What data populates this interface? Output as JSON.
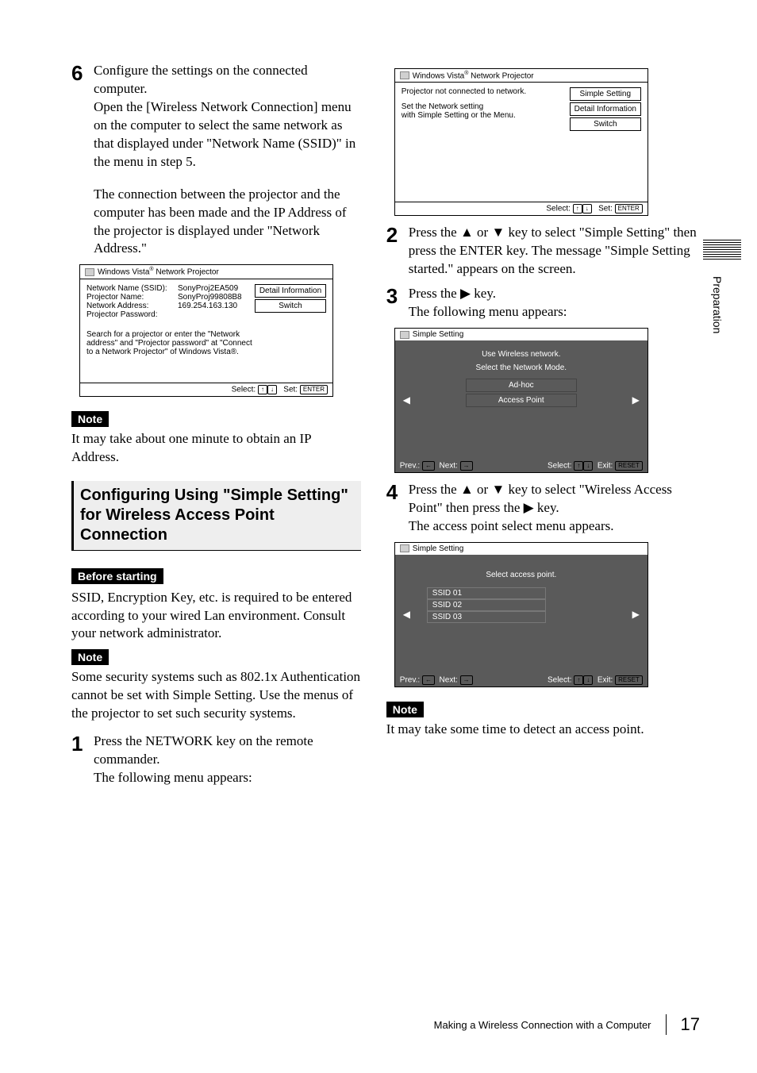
{
  "side_label": "Preparation",
  "left": {
    "step6_num": "6",
    "step6_a": "Configure the settings on the connected computer.",
    "step6_b": "Open the [Wireless Network Connection] menu on the computer to select the same network as that displayed under \"Network Name (SSID)\" in the menu in step 5.",
    "step6_c": "The connection between the projector and the computer has been made and the IP Address of the projector is displayed under \"Network Address.\"",
    "note1_label": "Note",
    "note1_text": "It may take about one minute to obtain an IP Address.",
    "section": "Configuring Using \"Simple Setting\" for Wireless Access Point Connection",
    "before_label": "Before starting",
    "before_text": "SSID, Encryption Key, etc. is required to be entered according to your wired Lan environment. Consult your network administrator.",
    "note2_label": "Note",
    "note2_text": "Some security systems such as 802.1x Authentication cannot be set with Simple Setting. Use the menus of the projector to set such security systems.",
    "step1_num": "1",
    "step1_a": "Press the NETWORK key on the remote commander.",
    "step1_b": "The following menu appears:"
  },
  "right": {
    "step2_num": "2",
    "step2_a": "Press the ▲ or ▼ key to select \"Simple Setting\" then press the ENTER key. The message \"Simple Setting started.\" appears on the screen.",
    "step3_num": "3",
    "step3_a": "Press the ▶ key.",
    "step3_b": "The following menu appears:",
    "step4_num": "4",
    "step4_a": "Press the ▲ or ▼ key to select \"Wireless Access Point\" then press the ▶ key.",
    "step4_b": "The access point select menu appears.",
    "note3_label": "Note",
    "note3_text": "It may take some time to detect an access point."
  },
  "panelA": {
    "title_pre": "Windows Vista",
    "title_post": " Network Projector",
    "rows": [
      {
        "label": "Network Name (SSID):",
        "val": "SonyProj2EA509"
      },
      {
        "label": "Projector Name:",
        "val": "SonyProj99808B8"
      },
      {
        "label": "Network Address:",
        "val": "169.254.163.130"
      },
      {
        "label": "Projector Password:",
        "val": ""
      }
    ],
    "btn1": "Detail Information",
    "btn2": "Switch",
    "msg": "Search for a projector or enter the \"Network address\" and \"Projector password\" at \"Connect to a Network Projector\" of Windows Vista®.",
    "foot_select": "Select:",
    "foot_set": "Set:",
    "foot_enter": "ENTER"
  },
  "panelB": {
    "title_pre": "Windows Vista",
    "title_post": " Network Projector",
    "line1": "Projector not connected to network.",
    "line2": "Set the Network setting",
    "line3": "with Simple Setting or the Menu.",
    "btn1": "Simple Setting",
    "btn2": "Detail Information",
    "btn3": "Switch",
    "foot_select": "Select:",
    "foot_set": "Set:",
    "foot_enter": "ENTER"
  },
  "panelC": {
    "title": "Simple Setting",
    "l1": "Use Wireless network.",
    "l2": "Select the Network Mode.",
    "opt1": "Ad-hoc",
    "opt2": "Access Point",
    "prev": "Prev.:",
    "next": "Next:",
    "sel": "Select:",
    "exit": "Exit:",
    "reset": "RESET"
  },
  "panelD": {
    "title": "Simple Setting",
    "l1": "Select access point.",
    "s1": "SSID 01",
    "s2": "SSID 02",
    "s3": "SSID 03",
    "prev": "Prev.:",
    "next": "Next:",
    "sel": "Select:",
    "exit": "Exit:",
    "reset": "RESET"
  },
  "footer": {
    "text": "Making a Wireless Connection with a Computer",
    "page": "17"
  }
}
